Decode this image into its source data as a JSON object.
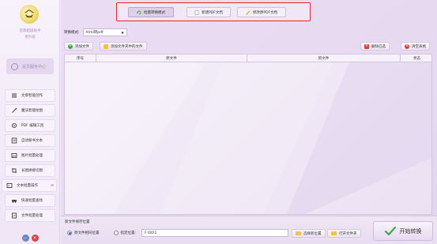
{
  "sidebar": {
    "app_name": "首款超级助手",
    "app_sub": "更升级",
    "account_label": "会员服务中心",
    "items": [
      {
        "label": "文章智能创作",
        "icon": "list-icon"
      },
      {
        "label": "魔法智能绘图",
        "icon": "pen-icon"
      },
      {
        "label": "PDF 编辑工具",
        "icon": "gear-icon"
      },
      {
        "label": "自动秘书文本",
        "icon": "document-icon"
      },
      {
        "label": "图片批量处理",
        "icon": "image-icon"
      },
      {
        "label": "长图拼接切图",
        "icon": "crop-icon"
      },
      {
        "label": "文本批量操作",
        "icon": "text-icon",
        "badge": "✉"
      },
      {
        "label": "快速批量查找",
        "icon": "search-car-icon"
      },
      {
        "label": "文件批量处理",
        "icon": "file-icon"
      }
    ]
  },
  "tabs": [
    {
      "label": "批量转换模式",
      "active": true
    },
    {
      "label": "新建PDF文档",
      "active": false
    },
    {
      "label": "修改原PDF文档",
      "active": false
    }
  ],
  "mode": {
    "label": "转换模式:",
    "value": "html转pdf",
    "arrow": "▼"
  },
  "toolbar": {
    "add_file": "添加文件",
    "add_folder": "添加文件夹中的文件",
    "delete_selected": "删除已选",
    "clear_table": "清空表格"
  },
  "table": {
    "columns": [
      "序号",
      "原文件",
      "新文件",
      "状态"
    ]
  },
  "save": {
    "title": "新文件保存位置",
    "option_original": "原文件相同位置",
    "option_custom": "指定位置:",
    "path": "F:\\00\\1",
    "choose_location": "选择新位置",
    "open_folder": "打开文件夹"
  },
  "start_button": "开始转换",
  "colors": {
    "highlight_border": "#e0262b",
    "accent": "#2a6cd8"
  }
}
